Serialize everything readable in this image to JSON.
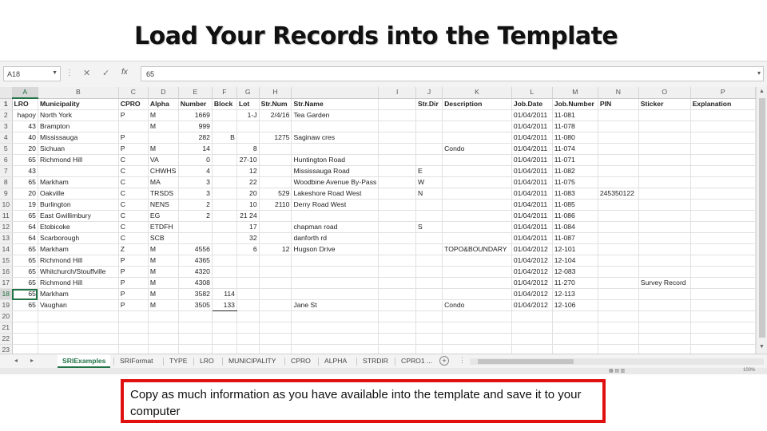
{
  "slide": {
    "title": "Load Your Records into the Template",
    "note": "Copy as much information as you have available into the template and save it to your computer"
  },
  "formula_bar": {
    "name_box": "A18",
    "dots": "⋮",
    "cancel": "✕",
    "enter": "✓",
    "fx": "fx",
    "value": "65"
  },
  "columns": [
    "A",
    "B",
    "C",
    "D",
    "E",
    "F",
    "G",
    "H",
    "I",
    "J",
    "K",
    "L",
    "M",
    "N",
    "O",
    "P"
  ],
  "rows": [
    {
      "n": "1",
      "cells": [
        "LRO",
        "Municipality",
        "CPRO",
        "Alpha",
        "Number",
        "Block",
        "Lot",
        "Str.Num",
        "Str.Name",
        "",
        "Str.Dir",
        "Description",
        "Job.Date",
        "Job.Number",
        "PIN",
        "Sticker",
        "Explanation"
      ]
    },
    {
      "n": "2",
      "cells": [
        "hapoy",
        "North York",
        "P",
        "M",
        "1669",
        "",
        "1-J",
        "2/4/16",
        "Tea Garden",
        "",
        "",
        "",
        "01/04/2011",
        "11-081",
        "",
        "",
        ""
      ]
    },
    {
      "n": "3",
      "cells": [
        "43",
        "Brampton",
        "",
        "M",
        "999",
        "",
        "",
        "",
        "",
        "",
        "",
        "",
        "01/04/2011",
        "11-078",
        "",
        "",
        ""
      ]
    },
    {
      "n": "4",
      "cells": [
        "40",
        "Mississauga",
        "P",
        "",
        "282",
        "B",
        "",
        "1275",
        "Saginaw cres",
        "",
        "",
        "",
        "01/04/2011",
        "11-080",
        "",
        "",
        ""
      ]
    },
    {
      "n": "5",
      "cells": [
        "20",
        "Sichuan",
        "P",
        "M",
        "14",
        "",
        "8",
        "",
        "",
        "",
        "",
        "Condo",
        "01/04/2011",
        "11-074",
        "",
        "",
        ""
      ]
    },
    {
      "n": "6",
      "cells": [
        "65",
        "Richmond Hill",
        "C",
        "VA",
        "0",
        "",
        "27-10",
        "",
        "Huntington Road",
        "",
        "",
        "",
        "01/04/2011",
        "11-071",
        "",
        "",
        ""
      ]
    },
    {
      "n": "7",
      "cells": [
        "43",
        "",
        "C",
        "CHWHS",
        "4",
        "",
        "12",
        "",
        "Mississauga Road",
        "",
        "E",
        "",
        "01/04/2011",
        "11-082",
        "",
        "",
        ""
      ]
    },
    {
      "n": "8",
      "cells": [
        "65",
        "Markham",
        "C",
        "MA",
        "3",
        "",
        "22",
        "",
        "Woodbine Avenue By-Pass",
        "",
        "W",
        "",
        "01/04/2011",
        "11-075",
        "",
        "",
        ""
      ]
    },
    {
      "n": "9",
      "cells": [
        "20",
        "Oakville",
        "C",
        "TRSDS",
        "3",
        "",
        "20",
        "529",
        "Lakeshore Road West",
        "",
        "N",
        "",
        "01/04/2011",
        "11-083",
        "245350122",
        "",
        ""
      ]
    },
    {
      "n": "10",
      "cells": [
        "19",
        "Burlington",
        "C",
        "NENS",
        "2",
        "",
        "10",
        "2110",
        "Derry Road West",
        "",
        "",
        "",
        "01/04/2011",
        "11-085",
        "",
        "",
        ""
      ]
    },
    {
      "n": "11",
      "cells": [
        "65",
        "East Gwillimbury",
        "C",
        "EG",
        "2",
        "",
        "21 24",
        "",
        "",
        "",
        "",
        "",
        "01/04/2011",
        "11-086",
        "",
        "",
        ""
      ]
    },
    {
      "n": "12",
      "cells": [
        "64",
        "Etobicoke",
        "C",
        "ETDFH",
        "",
        "",
        "17",
        "",
        "chapman road",
        "",
        "S",
        "",
        "01/04/2011",
        "11-084",
        "",
        "",
        ""
      ]
    },
    {
      "n": "13",
      "cells": [
        "64",
        "Scarborough",
        "C",
        "SCB",
        "",
        "",
        "32",
        "",
        "danforth rd",
        "",
        "",
        "",
        "01/04/2011",
        "11-087",
        "",
        "",
        ""
      ]
    },
    {
      "n": "14",
      "cells": [
        "65",
        "Markham",
        "Z",
        "M",
        "4556",
        "",
        "6",
        "12",
        "Hugson Drive",
        "",
        "",
        "TOPO&BOUNDARY",
        "01/04/2012",
        "12-101",
        "",
        "",
        ""
      ]
    },
    {
      "n": "15",
      "cells": [
        "65",
        "Richmond Hill",
        "P",
        "M",
        "4365",
        "",
        "",
        "",
        "",
        "",
        "",
        "",
        "01/04/2012",
        "12-104",
        "",
        "",
        ""
      ]
    },
    {
      "n": "16",
      "cells": [
        "65",
        "Whitchurch/Stouffville",
        "P",
        "M",
        "4320",
        "",
        "",
        "",
        "",
        "",
        "",
        "",
        "01/04/2012",
        "12-083",
        "",
        "",
        ""
      ]
    },
    {
      "n": "17",
      "cells": [
        "65",
        "Richmond Hill",
        "P",
        "M",
        "4308",
        "",
        "",
        "",
        "",
        "",
        "",
        "",
        "01/04/2012",
        "11-270",
        "",
        "Survey Record",
        ""
      ]
    },
    {
      "n": "18",
      "cells": [
        "65",
        "Markham",
        "P",
        "M",
        "3582",
        "114",
        "",
        "",
        "",
        "",
        "",
        "",
        "01/04/2012",
        "12-113",
        "",
        "",
        ""
      ]
    },
    {
      "n": "19",
      "cells": [
        "65",
        "Vaughan",
        "P",
        "M",
        "3505",
        "133",
        "",
        "",
        "Jane St",
        "",
        "",
        "Condo",
        "01/04/2012",
        "12-106",
        "",
        "",
        ""
      ]
    },
    {
      "n": "20",
      "cells": [
        "",
        "",
        "",
        "",
        "",
        "",
        "",
        "",
        "",
        "",
        "",
        "",
        "",
        "",
        "",
        "",
        ""
      ]
    },
    {
      "n": "21",
      "cells": [
        "",
        "",
        "",
        "",
        "",
        "",
        "",
        "",
        "",
        "",
        "",
        "",
        "",
        "",
        "",
        "",
        ""
      ]
    },
    {
      "n": "22",
      "cells": [
        "",
        "",
        "",
        "",
        "",
        "",
        "",
        "",
        "",
        "",
        "",
        "",
        "",
        "",
        "",
        "",
        ""
      ]
    },
    {
      "n": "23",
      "cells": [
        "",
        "",
        "",
        "",
        "",
        "",
        "",
        "",
        "",
        "",
        "",
        "",
        "",
        "",
        "",
        "",
        ""
      ]
    }
  ],
  "tabs": {
    "nav_prev": "◂",
    "nav_next": "▸",
    "sheets": [
      "SRIExamples",
      "SRIFormat",
      "TYPE",
      "LRO",
      "MUNICIPALITY",
      "CPRO",
      "ALPHA",
      "STRDIR",
      "CPRO1 ..."
    ],
    "active": "SRIExamples",
    "add": "+",
    "more": "⋮"
  },
  "status": {
    "zoom": "100%"
  },
  "colors": {
    "accent": "#217346",
    "note_border": "#e01010"
  }
}
